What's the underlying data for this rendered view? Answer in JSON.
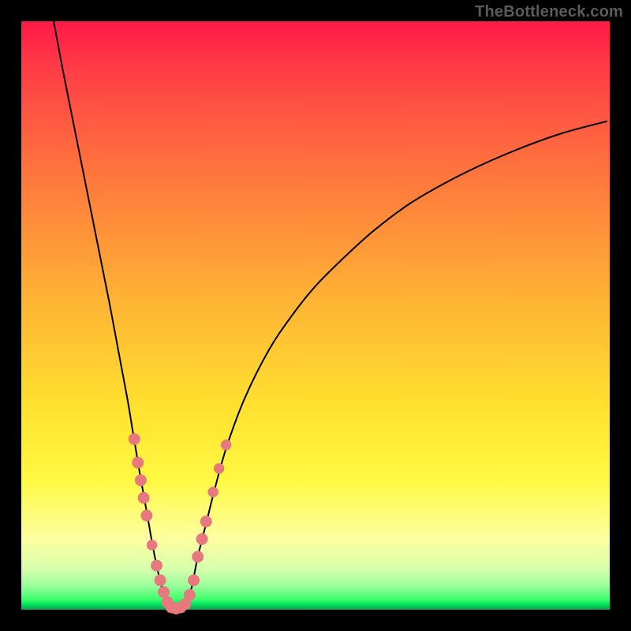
{
  "watermark": "TheBottleneck.com",
  "colors": {
    "frame_bg_top": "#ff1a47",
    "frame_bg_bottom": "#179f52",
    "curve": "#000000",
    "marker": "#e6787e",
    "page_bg": "#000000",
    "watermark_text": "#5b5b5b"
  },
  "chart_data": {
    "type": "line",
    "title": "",
    "xlabel": "",
    "ylabel": "",
    "xlim": [
      0,
      100
    ],
    "ylim": [
      0,
      100
    ],
    "grid": false,
    "legend": false,
    "series": [
      {
        "name": "left-branch",
        "x": [
          5.5,
          7,
          9,
          11,
          13,
          15,
          16.5,
          18,
          19,
          20,
          20.8,
          21.6,
          22.3,
          23,
          23.7,
          24.3,
          25
        ],
        "y": [
          100,
          92,
          82,
          72,
          62,
          52,
          44,
          36,
          30,
          24,
          19.5,
          15,
          11,
          7.5,
          4.5,
          2,
          0.5
        ]
      },
      {
        "name": "floor",
        "x": [
          25,
          25.5,
          26,
          26.5,
          27,
          27.5,
          28
        ],
        "y": [
          0.5,
          0.2,
          0.1,
          0.1,
          0.1,
          0.2,
          0.5
        ]
      },
      {
        "name": "right-branch",
        "x": [
          28,
          29,
          30,
          31.5,
          33,
          35,
          38,
          42,
          46,
          50,
          55,
          60,
          66,
          72,
          78,
          85,
          92,
          99.5
        ],
        "y": [
          0.5,
          4,
          9,
          15,
          21,
          28,
          36,
          44,
          50,
          55,
          60,
          64.5,
          69,
          72.5,
          75.5,
          78.5,
          81,
          83
        ]
      }
    ],
    "markers": [
      {
        "x": 19.2,
        "y": 29,
        "r": 1.0
      },
      {
        "x": 19.8,
        "y": 25,
        "r": 1.0
      },
      {
        "x": 20.3,
        "y": 22,
        "r": 1.0
      },
      {
        "x": 20.8,
        "y": 19,
        "r": 1.0
      },
      {
        "x": 21.3,
        "y": 16,
        "r": 1.0
      },
      {
        "x": 22.2,
        "y": 11,
        "r": 0.9
      },
      {
        "x": 23.0,
        "y": 7.5,
        "r": 1.0
      },
      {
        "x": 23.6,
        "y": 5,
        "r": 1.0
      },
      {
        "x": 24.2,
        "y": 3,
        "r": 1.0
      },
      {
        "x": 24.8,
        "y": 1.3,
        "r": 1.0
      },
      {
        "x": 25.5,
        "y": 0.4,
        "r": 1.0
      },
      {
        "x": 26.3,
        "y": 0.2,
        "r": 1.0
      },
      {
        "x": 27.1,
        "y": 0.4,
        "r": 1.0
      },
      {
        "x": 27.9,
        "y": 1.0,
        "r": 1.0
      },
      {
        "x": 28.6,
        "y": 2.5,
        "r": 1.0
      },
      {
        "x": 29.3,
        "y": 5,
        "r": 1.0
      },
      {
        "x": 30.0,
        "y": 9,
        "r": 1.0
      },
      {
        "x": 30.7,
        "y": 12,
        "r": 1.0
      },
      {
        "x": 31.4,
        "y": 15,
        "r": 1.0
      },
      {
        "x": 32.6,
        "y": 20,
        "r": 0.9
      },
      {
        "x": 33.6,
        "y": 24,
        "r": 0.9
      },
      {
        "x": 34.8,
        "y": 28,
        "r": 0.9
      }
    ]
  }
}
